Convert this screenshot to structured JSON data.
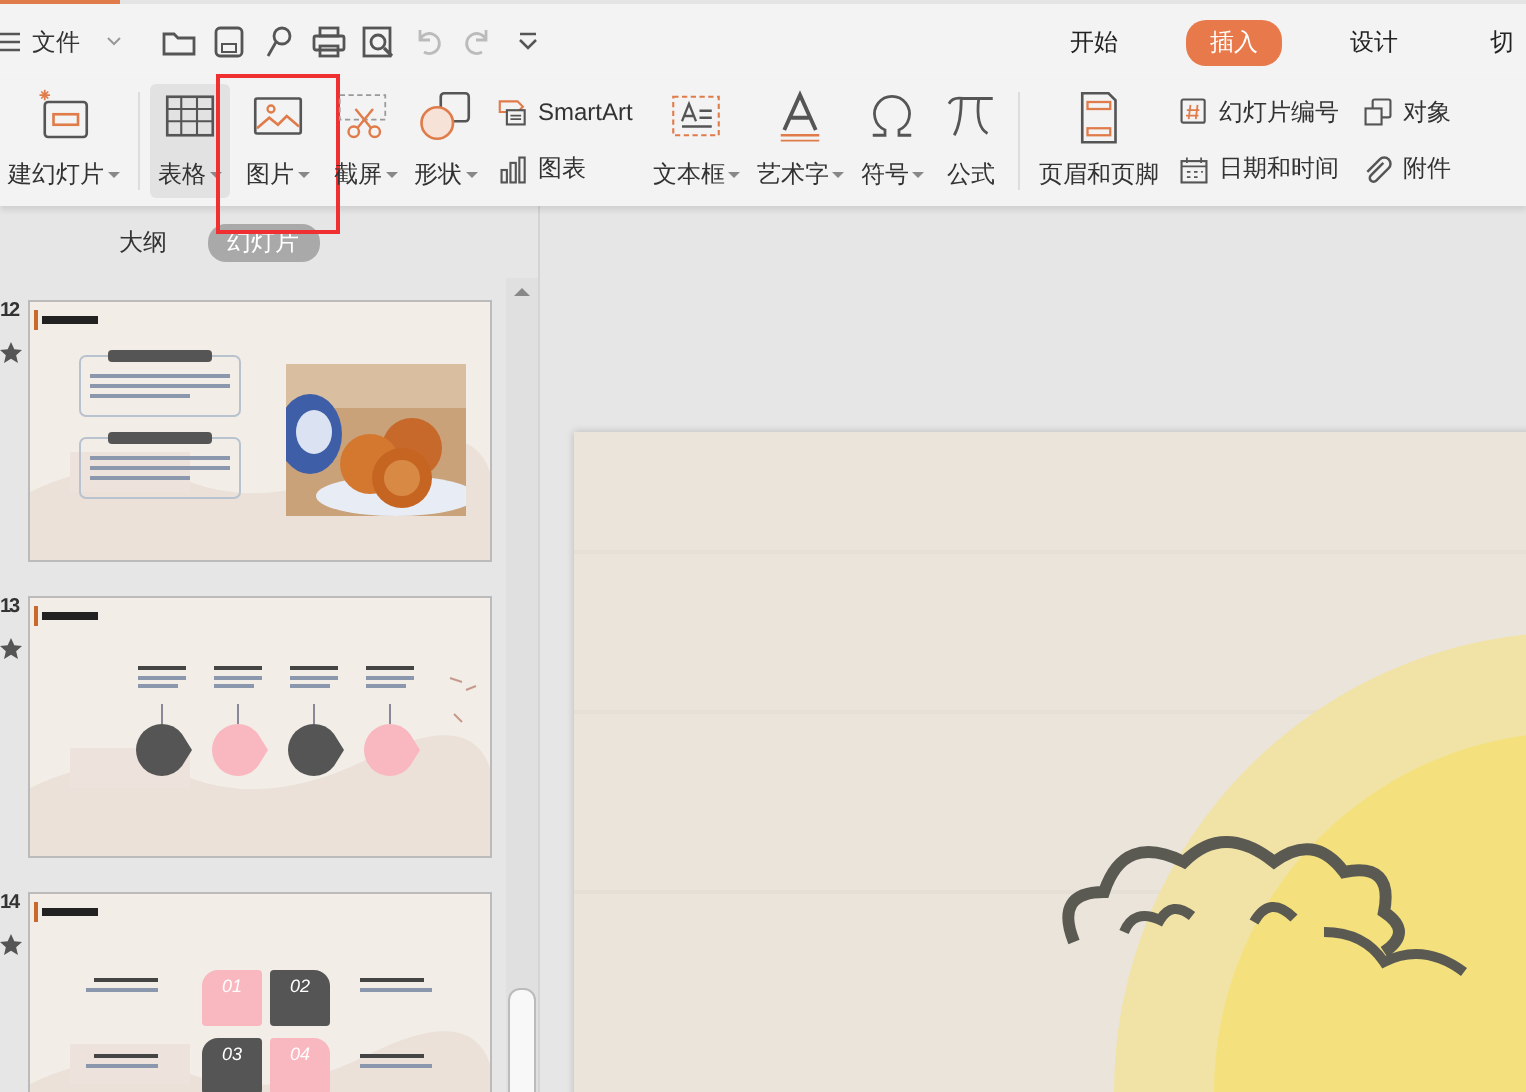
{
  "menu": {
    "label": "文件"
  },
  "quick_access": [
    {
      "disabled": false
    },
    {
      "disabled": false
    },
    {
      "disabled": false
    },
    {
      "disabled": false
    },
    {
      "disabled": false
    },
    {
      "disabled": true
    },
    {
      "disabled": true
    },
    {
      "disabled": false
    }
  ],
  "tabs": [
    {
      "label": "开始",
      "selected": false
    },
    {
      "label": "插入",
      "selected": true
    },
    {
      "label": "设计",
      "selected": false
    },
    {
      "label": "切",
      "selected": false
    }
  ],
  "ribbon": [
    {
      "kind": "large",
      "label": "建幻灯片",
      "dropdown": true,
      "selected": false,
      "highlighted": false
    },
    {
      "kind": "separator"
    },
    {
      "kind": "large",
      "label": "表格",
      "dropdown": true,
      "selected": true,
      "highlighted": false
    },
    {
      "kind": "large",
      "label": "图片",
      "dropdown": true,
      "selected": false,
      "highlighted": true
    },
    {
      "kind": "large",
      "label": "截屏",
      "dropdown": true,
      "selected": false,
      "highlighted": false
    },
    {
      "kind": "large",
      "label": "形状",
      "dropdown": true,
      "selected": false,
      "highlighted": false
    },
    {
      "kind": "pair",
      "items": [
        {
          "label": "SmartArt"
        },
        {
          "label": "图表"
        }
      ]
    },
    {
      "kind": "large",
      "label": "文本框",
      "dropdown": true,
      "selected": false,
      "highlighted": false
    },
    {
      "kind": "large",
      "label": "艺术字",
      "dropdown": true,
      "selected": false,
      "highlighted": false
    },
    {
      "kind": "large",
      "label": "符号",
      "dropdown": true,
      "selected": false,
      "highlighted": false
    },
    {
      "kind": "large",
      "label": "公式",
      "dropdown": false,
      "selected": false,
      "highlighted": false
    },
    {
      "kind": "separator"
    },
    {
      "kind": "large",
      "label": "页眉和页脚",
      "dropdown": false,
      "selected": false,
      "highlighted": false
    },
    {
      "kind": "pair",
      "items": [
        {
          "label": "幻灯片编号"
        },
        {
          "label": "日期和时间"
        }
      ]
    },
    {
      "kind": "pair",
      "items": [
        {
          "label": "对象"
        },
        {
          "label": "附件"
        }
      ]
    }
  ],
  "panel_tabs": [
    {
      "label": "大纲",
      "selected": false
    },
    {
      "label": "幻灯片",
      "selected": true
    }
  ],
  "slides": [
    {
      "number": "12"
    },
    {
      "number": "13",
      "kind": "steps"
    },
    {
      "number": "14",
      "kind": "grid",
      "tiles": [
        "01",
        "02",
        "03",
        "04"
      ]
    }
  ]
}
